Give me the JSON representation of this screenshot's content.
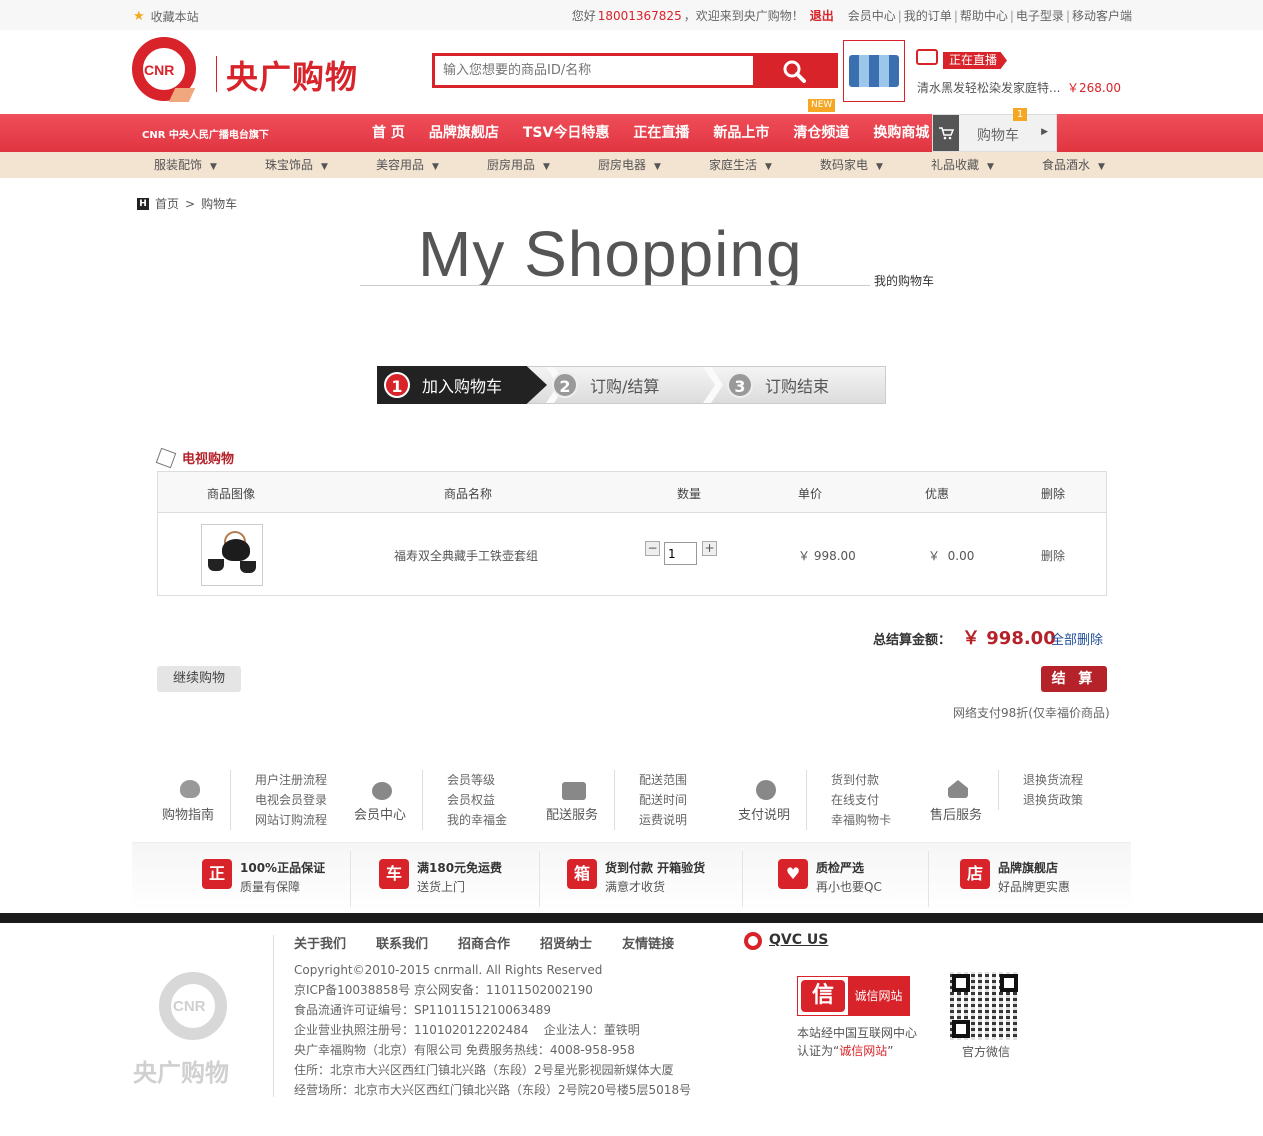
{
  "topbar": {
    "favorite": "收藏本站",
    "greeting_prefix": "您好",
    "phone": "18001367825",
    "greeting_suffix": "，欢迎来到央广购物！",
    "logout": "退出",
    "links": [
      "会员中心",
      "我的订单",
      "帮助中心",
      "电子型录",
      "移动客户端"
    ]
  },
  "header": {
    "logo_mark": "CNR",
    "logo_text": "央广购物",
    "search_placeholder": "输入您想要的商品ID/名称",
    "live_badge": "正在直播",
    "live_title": "清水黑发轻松染发家庭特...",
    "live_price": "￥268.00"
  },
  "nav": {
    "brand": "CNR 中央人民广播电台旗下",
    "links": [
      "首 页",
      "品牌旗舰店",
      "TSV今日特惠",
      "正在直播",
      "新品上市",
      "清仓频道",
      "换购商城"
    ],
    "new_badge": "NEW",
    "cart_label": "购物车",
    "cart_count": "1"
  },
  "categories": [
    "服装配饰",
    "珠宝饰品",
    "美容用品",
    "厨房用品",
    "厨房电器",
    "家庭生活",
    "数码家电",
    "礼品收藏",
    "食品酒水"
  ],
  "breadcrumb": {
    "home": "首页",
    "sep": ">",
    "current": "购物车"
  },
  "page_title": {
    "big": "My Shopping",
    "small": "我的购物车"
  },
  "steps": [
    {
      "num": "1",
      "label": "加入购物车"
    },
    {
      "num": "2",
      "label": "订购/结算"
    },
    {
      "num": "3",
      "label": "订购结束"
    }
  ],
  "cart": {
    "section_title": "电视购物",
    "headers": [
      "商品图像",
      "商品名称",
      "数量",
      "单价",
      "优惠",
      "删除"
    ],
    "item": {
      "name": "福寿双全典藏手工铁壶套组",
      "qty": "1",
      "price": "￥ 998.00",
      "discount": "￥  0.00",
      "delete": "删除"
    },
    "minus": "−",
    "plus": "+",
    "total_label": "总结算金额：",
    "total_value": "￥ 998.00",
    "clear_all": "全部删除",
    "continue": "继续购物",
    "checkout": "结 算",
    "pay_note": "网络支付98折(仅幸福价商品)"
  },
  "help": [
    {
      "title": "购物指南",
      "links": [
        "用户注册流程",
        "电视会员登录",
        "网站订购流程"
      ]
    },
    {
      "title": "会员中心",
      "links": [
        "会员等级",
        "会员权益",
        "我的幸福金"
      ]
    },
    {
      "title": "配送服务",
      "links": [
        "配送范围",
        "配送时间",
        "运费说明"
      ]
    },
    {
      "title": "支付说明",
      "links": [
        "货到付款",
        "在线支付",
        "幸福购物卡"
      ]
    },
    {
      "title": "售后服务",
      "links": [
        "退换货流程",
        "退换货政策"
      ]
    }
  ],
  "guarantees": [
    {
      "icon": "正",
      "t1": "100%正品保证",
      "t2": "质量有保障"
    },
    {
      "icon": "车",
      "t1": "满180元免运费",
      "t2": "送货上门"
    },
    {
      "icon": "箱",
      "t1": "货到付款  开箱验货",
      "t2": "满意才收货"
    },
    {
      "icon": "♥",
      "t1": "质检严选",
      "t2": "再小也要QC"
    },
    {
      "icon": "店",
      "t1": "品牌旗舰店",
      "t2": "好品牌更实惠"
    }
  ],
  "footer": {
    "logo_mark": "CNR",
    "logo_text": "央广购物",
    "links": [
      "关于我们",
      "联系我们",
      "招商合作",
      "招贤纳士",
      "友情链接"
    ],
    "qvc": "QVC US",
    "info": [
      "Copyright©2010-2015 cnrmall. All Rights Reserved",
      "京ICP备10038858号 京公网安备：11011502002190",
      "食品流通许可证编号：SP1101151210063489",
      "企业营业执照注册号：110102012202484    企业法人：董铁明",
      "央广幸福购物（北京）有限公司 免费服务热线：4008-958-958",
      "住所：北京市大兴区西红门镇北兴路（东段）2号星光影视园新媒体大厦",
      "经营场所：北京市大兴区西红门镇北兴路（东段）2号院20号楼5层5018号"
    ],
    "trust_char": "信",
    "trust_label": "诚信网站",
    "trust_text1": "本站经中国互联网中心",
    "trust_text2_prefix": "认证为“",
    "trust_text2_hl": "诚信网站",
    "trust_text2_suffix": "”",
    "qr_caption": "官方微信"
  }
}
